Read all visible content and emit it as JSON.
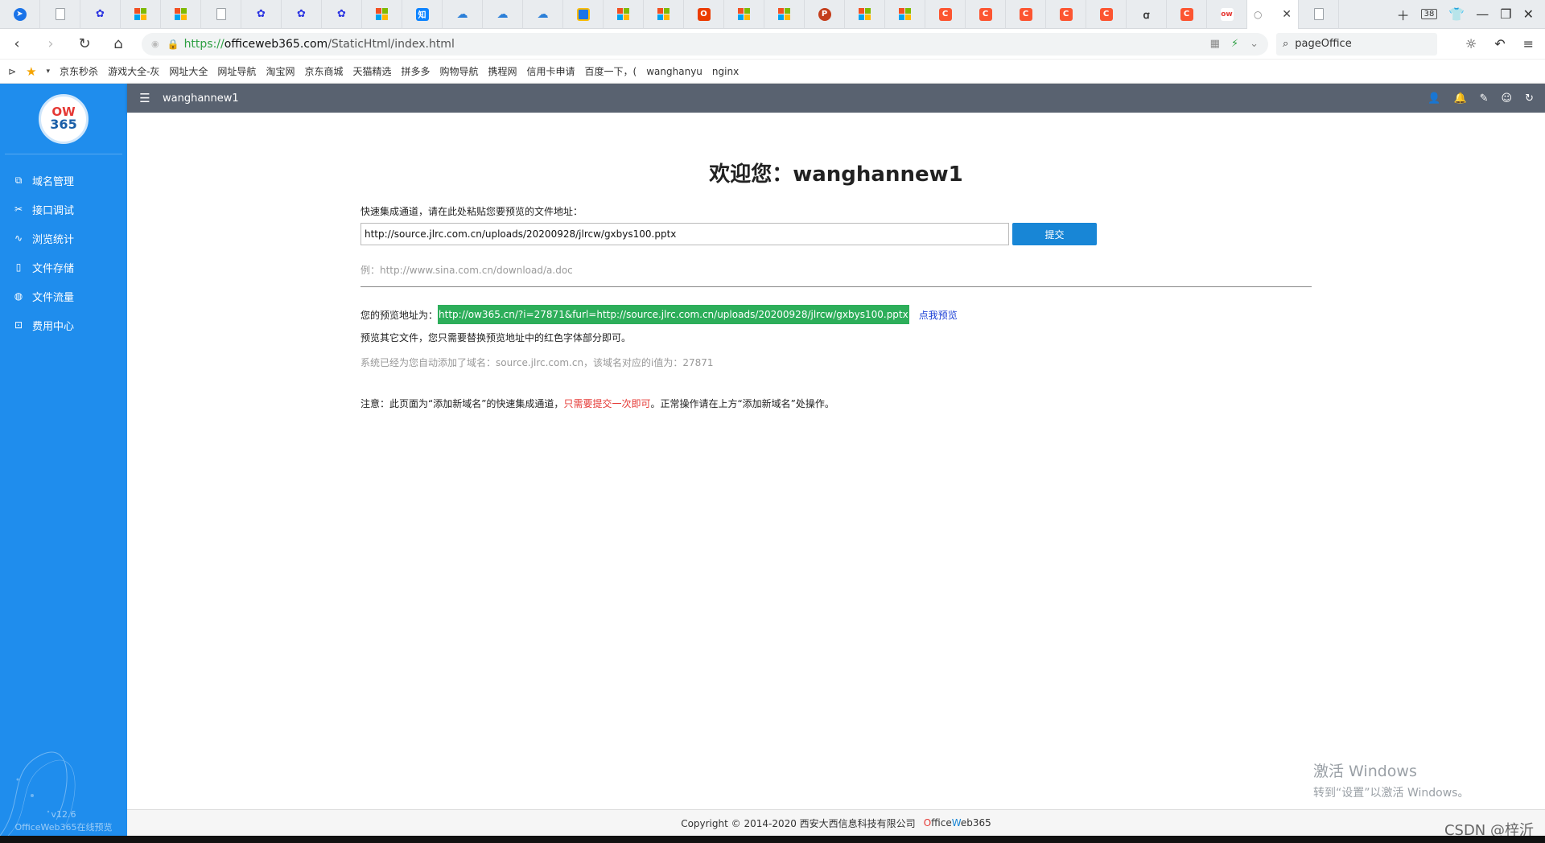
{
  "browser": {
    "active_tab_close": "✕",
    "tab_count": "38",
    "url_scheme": "https://",
    "url_host": "officeweb365.com",
    "url_path": "/StaticHtml/index.html",
    "search_value": "pageOffice",
    "bookmarks": [
      "京东秒杀",
      "游戏大全-灰",
      "网址大全",
      "网址导航",
      "淘宝网",
      "京东商城",
      "天猫精选",
      "拼多多",
      "购物导航",
      "携程网",
      "信用卡申请",
      "百度一下，(",
      "wanghanyu",
      "nginx"
    ]
  },
  "sidebar": {
    "logo_top": "OW",
    "logo_bottom": "365",
    "menu": [
      {
        "label": "域名管理",
        "icon": "domain-icon"
      },
      {
        "label": "接口调试",
        "icon": "debug-icon"
      },
      {
        "label": "浏览统计",
        "icon": "stats-icon"
      },
      {
        "label": "文件存储",
        "icon": "file-icon"
      },
      {
        "label": "文件流量",
        "icon": "globe-icon"
      },
      {
        "label": "费用中心",
        "icon": "billing-icon"
      }
    ],
    "version": "v12.6",
    "product": "OfficeWeb365在线预览"
  },
  "header": {
    "username": "wanghannew1"
  },
  "main": {
    "welcome": "欢迎您：wanghannew1",
    "input_label": "快速集成通道，请在此处粘贴您要预览的文件地址：",
    "input_value": "http://source.jlrc.com.cn/uploads/20200928/jlrcw/gxbys100.pptx",
    "submit_label": "提交",
    "example": "例：http://www.sina.com.cn/download/a.doc",
    "preview_label": "您的预览地址为：",
    "preview_url": "http://ow365.cn/?i=27871&furl=http://source.jlrc.com.cn/uploads/20200928/jlrcw/gxbys100.pptx",
    "click_preview": "点我预览",
    "hint": "预览其它文件，您只需要替换预览地址中的红色字体部分即可。",
    "system_note": "系统已经为您自动添加了域名：source.jlrc.com.cn，该域名对应的i值为：27871",
    "notice_prefix": "注意：此页面为“添加新域名”的快速集成通道，",
    "notice_red": "只需要提交一次即可",
    "notice_suffix": "。正常操作请在上方“添加新域名”处操作。"
  },
  "footer": {
    "copyright": "Copyright © 2014-2020 西安大西信息科技有限公司",
    "brand_o": "O",
    "brand_ffice": "ffice",
    "brand_w": "W",
    "brand_eb": "eb365"
  },
  "overlay": {
    "activate_title": "激活 Windows",
    "activate_sub": "转到“设置”以激活 Windows。",
    "watermark": "CSDN @梓沂"
  },
  "colors": {
    "sidebar": "#1f8ded",
    "header": "#596270",
    "submit": "#1886d6",
    "preview_highlight": "#2dae5a",
    "notice_red": "#e53935"
  }
}
